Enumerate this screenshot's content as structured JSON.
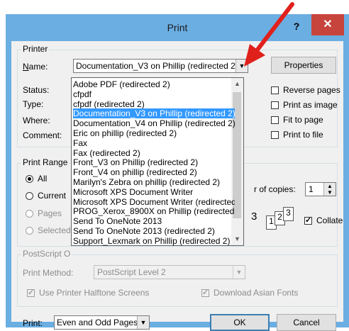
{
  "window": {
    "title": "Print",
    "help_label": "?",
    "close_label": "✕"
  },
  "printer": {
    "group_label": "Printer",
    "name_label": "Name:",
    "selected_printer": "Documentation_V3 on Phillip (redirected 2)",
    "properties_label": "Properties",
    "status_label": "Status:",
    "type_label": "Type:",
    "where_label": "Where:",
    "comment_label": "Comment:",
    "options": [
      {
        "label": "Reverse pages",
        "checked": false
      },
      {
        "label": "Print as image",
        "checked": false
      },
      {
        "label": "Fit to page",
        "checked": false
      },
      {
        "label": "Print to file",
        "checked": false
      }
    ]
  },
  "printer_list": [
    "Adobe PDF (redirected 2)",
    "cfpdf",
    "cfpdf (redirected 2)",
    "Documentation_V3 on Phillip (redirected 2)",
    "Documentation_V4 on Phillip (redirected 2)",
    "Eric on phillip (redirected 2)",
    "Fax",
    "Fax (redirected 2)",
    "Front_V3 on Phillip (redirected 2)",
    "Front_V4 on phillip (redirected 2)",
    "Marilyn's Zebra on phillip (redirected 2)",
    "Microsoft XPS Document Writer",
    "Microsoft XPS Document Writer (redirected",
    "PROG_Xerox_8900X on Phillip (redirected 2",
    "Send To OneNote 2013",
    "Send To OneNote 2013 (redirected 2)",
    "Support_Lexmark on Phillip (redirected 2)"
  ],
  "selected_index": 3,
  "print_range": {
    "group_label": "Print Range",
    "all_label": "All",
    "current_label": "Current",
    "pages_label": "Pages",
    "selected_label": "Selected"
  },
  "copies": {
    "label": "r of copies:",
    "value": "1",
    "collate_label": "Collate",
    "collate_checked": true,
    "glyph_a": "3",
    "glyph_b1": "1",
    "glyph_b2": "2",
    "glyph_b3": "3"
  },
  "postscript": {
    "group_label": "PostScript O",
    "method_label": "Print Method:",
    "method_value": "PostScript Level 2",
    "halftone_label": "Use Printer Halftone Screens",
    "download_fonts_label": "Download Asian Fonts"
  },
  "footer": {
    "print_label": "Print:",
    "print_value": "Even and Odd Pages",
    "ok_label": "OK",
    "cancel_label": "Cancel"
  },
  "colors": {
    "frame": "#6aaee2",
    "close": "#c7443c",
    "selection": "#3399ff",
    "annotation_arrow": "#e0201b"
  }
}
